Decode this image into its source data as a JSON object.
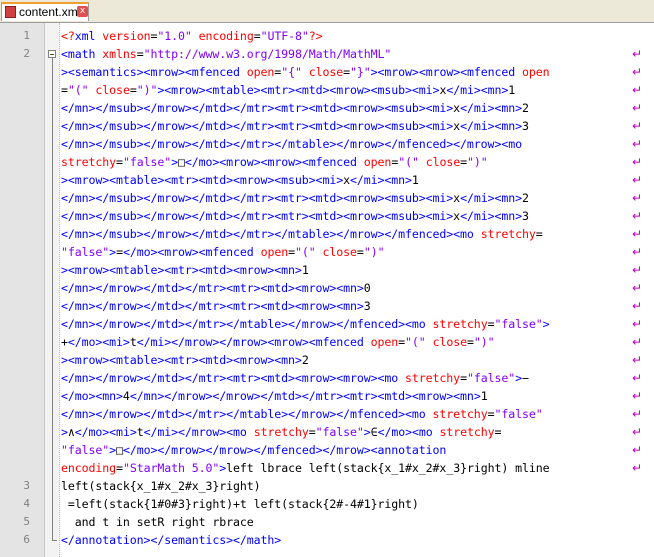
{
  "tab": {
    "label": "content.xml",
    "icon": "file-icon",
    "close": "x"
  },
  "lines": [
    {
      "num": "1",
      "wrap": false,
      "segs": [
        [
          "pi",
          "<?"
        ],
        [
          "cont",
          "xml "
        ],
        [
          "attr",
          "version"
        ],
        [
          "plain",
          "="
        ],
        [
          "val",
          "\"1.0\""
        ],
        [
          "cont",
          " "
        ],
        [
          "attr",
          "encoding"
        ],
        [
          "plain",
          "="
        ],
        [
          "val",
          "\"UTF-8\""
        ],
        [
          "pi",
          "?>"
        ]
      ]
    },
    {
      "num": "2",
      "wrap": true,
      "segs": [
        [
          "cont",
          "<math "
        ],
        [
          "attr",
          "xmlns"
        ],
        [
          "plain",
          "="
        ],
        [
          "val",
          "\"http://www.w3.org/1998/Math/MathML\""
        ]
      ]
    },
    {
      "num": "",
      "wrap": true,
      "segs": [
        [
          "cont",
          "><semantics><mrow><mfenced "
        ],
        [
          "attr",
          "open"
        ],
        [
          "plain",
          "="
        ],
        [
          "val",
          "\"{\""
        ],
        [
          "cont",
          " "
        ],
        [
          "attr",
          "close"
        ],
        [
          "plain",
          "="
        ],
        [
          "val",
          "\"}\""
        ],
        [
          "cont",
          "><mrow><mrow><mfenced "
        ],
        [
          "attr",
          "open"
        ]
      ]
    },
    {
      "num": "",
      "wrap": true,
      "segs": [
        [
          "plain",
          "="
        ],
        [
          "val",
          "\"(\""
        ],
        [
          "cont",
          " "
        ],
        [
          "attr",
          "close"
        ],
        [
          "plain",
          "="
        ],
        [
          "val",
          "\")\""
        ],
        [
          "cont",
          "><mrow><mtable><mtr><mtd><mrow><msub><mi>"
        ],
        [
          "plain",
          "x"
        ],
        [
          "cont",
          "</mi><mn>"
        ],
        [
          "plain",
          "1"
        ]
      ]
    },
    {
      "num": "",
      "wrap": true,
      "segs": [
        [
          "cont",
          "</mn></msub></mrow></mtd></mtr><mtr><mtd><mrow><msub><mi>"
        ],
        [
          "plain",
          "x"
        ],
        [
          "cont",
          "</mi><mn>"
        ],
        [
          "plain",
          "2"
        ]
      ]
    },
    {
      "num": "",
      "wrap": true,
      "segs": [
        [
          "cont",
          "</mn></msub></mrow></mtd></mtr><mtr><mtd><mrow><msub><mi>"
        ],
        [
          "plain",
          "x"
        ],
        [
          "cont",
          "</mi><mn>"
        ],
        [
          "plain",
          "3"
        ]
      ]
    },
    {
      "num": "",
      "wrap": true,
      "segs": [
        [
          "cont",
          "</mn></msub></mrow></mtd></mtr></mtable></mrow></mfenced></mrow><mo "
        ]
      ]
    },
    {
      "num": "",
      "wrap": true,
      "segs": [
        [
          "attr",
          "stretchy"
        ],
        [
          "plain",
          "="
        ],
        [
          "val",
          "\"false\""
        ],
        [
          "cont",
          ">"
        ],
        [
          "plain",
          "□"
        ],
        [
          "cont",
          "</mo><mrow><mrow><mfenced "
        ],
        [
          "attr",
          "open"
        ],
        [
          "plain",
          "="
        ],
        [
          "val",
          "\"(\""
        ],
        [
          "cont",
          " "
        ],
        [
          "attr",
          "close"
        ],
        [
          "plain",
          "="
        ],
        [
          "val",
          "\")\""
        ]
      ]
    },
    {
      "num": "",
      "wrap": true,
      "segs": [
        [
          "cont",
          "><mrow><mtable><mtr><mtd><mrow><msub><mi>"
        ],
        [
          "plain",
          "x"
        ],
        [
          "cont",
          "</mi><mn>"
        ],
        [
          "plain",
          "1"
        ]
      ]
    },
    {
      "num": "",
      "wrap": true,
      "segs": [
        [
          "cont",
          "</mn></msub></mrow></mtd></mtr><mtr><mtd><mrow><msub><mi>"
        ],
        [
          "plain",
          "x"
        ],
        [
          "cont",
          "</mi><mn>"
        ],
        [
          "plain",
          "2"
        ]
      ]
    },
    {
      "num": "",
      "wrap": true,
      "segs": [
        [
          "cont",
          "</mn></msub></mrow></mtd></mtr><mtr><mtd><mrow><msub><mi>"
        ],
        [
          "plain",
          "x"
        ],
        [
          "cont",
          "</mi><mn>"
        ],
        [
          "plain",
          "3"
        ]
      ]
    },
    {
      "num": "",
      "wrap": true,
      "segs": [
        [
          "cont",
          "</mn></msub></mrow></mtd></mtr></mtable></mrow></mfenced><mo "
        ],
        [
          "attr",
          "stretchy"
        ],
        [
          "plain",
          "="
        ]
      ]
    },
    {
      "num": "",
      "wrap": true,
      "segs": [
        [
          "val",
          "\"false\""
        ],
        [
          "cont",
          ">"
        ],
        [
          "plain",
          "="
        ],
        [
          "cont",
          "</mo><mrow><mfenced "
        ],
        [
          "attr",
          "open"
        ],
        [
          "plain",
          "="
        ],
        [
          "val",
          "\"(\""
        ],
        [
          "cont",
          " "
        ],
        [
          "attr",
          "close"
        ],
        [
          "plain",
          "="
        ],
        [
          "val",
          "\")\""
        ]
      ]
    },
    {
      "num": "",
      "wrap": true,
      "segs": [
        [
          "cont",
          "><mrow><mtable><mtr><mtd><mrow><mn>"
        ],
        [
          "plain",
          "1"
        ]
      ]
    },
    {
      "num": "",
      "wrap": true,
      "segs": [
        [
          "cont",
          "</mn></mrow></mtd></mtr><mtr><mtd><mrow><mn>"
        ],
        [
          "plain",
          "0"
        ]
      ]
    },
    {
      "num": "",
      "wrap": true,
      "segs": [
        [
          "cont",
          "</mn></mrow></mtd></mtr><mtr><mtd><mrow><mn>"
        ],
        [
          "plain",
          "3"
        ]
      ]
    },
    {
      "num": "",
      "wrap": true,
      "segs": [
        [
          "cont",
          "</mn></mrow></mtd></mtr></mtable></mrow></mfenced><mo "
        ],
        [
          "attr",
          "stretchy"
        ],
        [
          "plain",
          "="
        ],
        [
          "val",
          "\"false\""
        ],
        [
          "cont",
          ">"
        ]
      ]
    },
    {
      "num": "",
      "wrap": true,
      "segs": [
        [
          "plain",
          "+"
        ],
        [
          "cont",
          "</mo><mi>"
        ],
        [
          "plain",
          "t"
        ],
        [
          "cont",
          "</mi></mrow></mrow><mrow><mfenced "
        ],
        [
          "attr",
          "open"
        ],
        [
          "plain",
          "="
        ],
        [
          "val",
          "\"(\""
        ],
        [
          "cont",
          " "
        ],
        [
          "attr",
          "close"
        ],
        [
          "plain",
          "="
        ],
        [
          "val",
          "\")\""
        ]
      ]
    },
    {
      "num": "",
      "wrap": true,
      "segs": [
        [
          "cont",
          "><mrow><mtable><mtr><mtd><mrow><mn>"
        ],
        [
          "plain",
          "2"
        ]
      ]
    },
    {
      "num": "",
      "wrap": true,
      "segs": [
        [
          "cont",
          "</mn></mrow></mtd></mtr><mtr><mtd><mrow><mrow><mo "
        ],
        [
          "attr",
          "stretchy"
        ],
        [
          "plain",
          "="
        ],
        [
          "val",
          "\"false\""
        ],
        [
          "cont",
          ">"
        ],
        [
          "plain",
          "−"
        ]
      ]
    },
    {
      "num": "",
      "wrap": true,
      "segs": [
        [
          "cont",
          "</mo><mn>"
        ],
        [
          "plain",
          "4"
        ],
        [
          "cont",
          "</mn></mrow></mrow></mtd></mtr><mtr><mtd><mrow><mn>"
        ],
        [
          "plain",
          "1"
        ]
      ]
    },
    {
      "num": "",
      "wrap": true,
      "segs": [
        [
          "cont",
          "</mn></mrow></mtd></mtr></mtable></mrow></mfenced><mo "
        ],
        [
          "attr",
          "stretchy"
        ],
        [
          "plain",
          "="
        ],
        [
          "val",
          "\"false\""
        ]
      ]
    },
    {
      "num": "",
      "wrap": true,
      "segs": [
        [
          "cont",
          ">"
        ],
        [
          "plain",
          "∧"
        ],
        [
          "cont",
          "</mo><mi>"
        ],
        [
          "plain",
          "t"
        ],
        [
          "cont",
          "</mi></mrow><mo "
        ],
        [
          "attr",
          "stretchy"
        ],
        [
          "plain",
          "="
        ],
        [
          "val",
          "\"false\""
        ],
        [
          "cont",
          ">"
        ],
        [
          "plain",
          "∈"
        ],
        [
          "cont",
          "</mo><mo "
        ],
        [
          "attr",
          "stretchy"
        ],
        [
          "plain",
          "="
        ]
      ]
    },
    {
      "num": "",
      "wrap": true,
      "segs": [
        [
          "val",
          "\"false\""
        ],
        [
          "cont",
          ">"
        ],
        [
          "plain",
          "□"
        ],
        [
          "cont",
          "</mo></mrow></mrow></mfenced></mrow><annotation"
        ]
      ]
    },
    {
      "num": "",
      "wrap": true,
      "segs": [
        [
          "attr",
          "encoding"
        ],
        [
          "plain",
          "="
        ],
        [
          "val",
          "\"StarMath 5.0\""
        ],
        [
          "cont",
          ">"
        ],
        [
          "plain",
          "left lbrace left(stack{x_1#x_2#x_3}right) mline"
        ]
      ]
    },
    {
      "num": "3",
      "wrap": false,
      "segs": [
        [
          "plain",
          "left(stack{x_1#x_2#x_3}right)"
        ]
      ]
    },
    {
      "num": "4",
      "wrap": false,
      "segs": [
        [
          "plain",
          " =left(stack{1#0#3}right)+t left(stack{2#-4#1}right)"
        ]
      ]
    },
    {
      "num": "5",
      "wrap": false,
      "segs": [
        [
          "plain",
          "  and t in setR right rbrace"
        ]
      ]
    },
    {
      "num": "6",
      "wrap": false,
      "segs": [
        [
          "cont",
          "</annotation></semantics></math>"
        ]
      ]
    }
  ]
}
